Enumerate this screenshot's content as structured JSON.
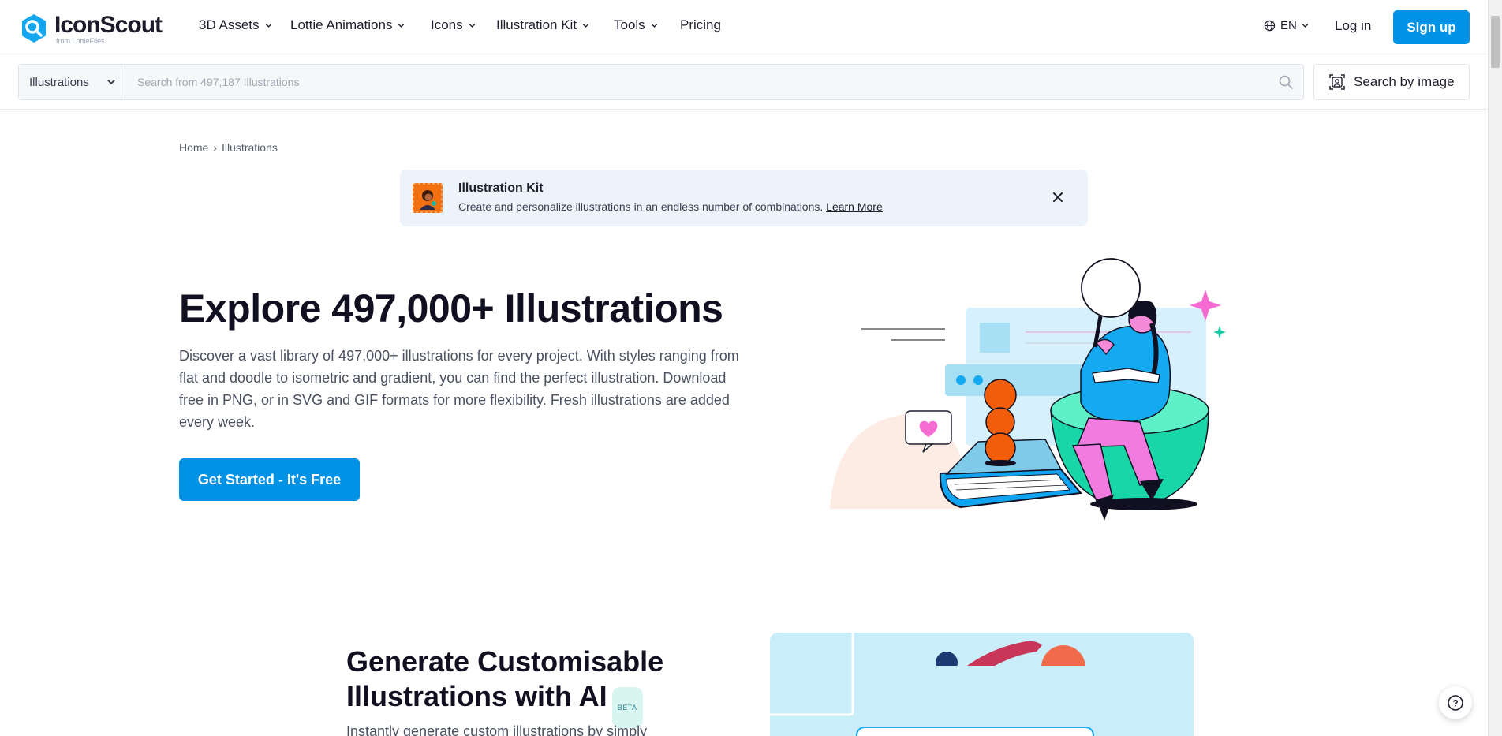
{
  "brand": {
    "name": "IconScout",
    "sub": "from LottieFiles",
    "accent": "#0092e4"
  },
  "nav": {
    "items": [
      {
        "label": "3D Assets",
        "dropdown": true
      },
      {
        "label": "Lottie Animations",
        "dropdown": true
      },
      {
        "label": "Icons",
        "dropdown": true
      },
      {
        "label": "Illustration Kit",
        "dropdown": true
      },
      {
        "label": "Tools",
        "dropdown": true
      },
      {
        "label": "Pricing",
        "dropdown": false
      }
    ],
    "language": "EN",
    "login": "Log in",
    "signup": "Sign up"
  },
  "search": {
    "category": "Illustrations",
    "placeholder": "Search from 497,187 Illustrations",
    "image_search": "Search by image"
  },
  "breadcrumb": {
    "home": "Home",
    "separator": "›",
    "current": "Illustrations"
  },
  "banner": {
    "title": "Illustration Kit",
    "description": "Create and personalize illustrations in an endless number of combinations.",
    "link": "Learn More"
  },
  "hero": {
    "title": "Explore 497,000+ Illustrations",
    "description": "Discover a vast library of 497,000+ illustrations for every project. With styles ranging from flat and doodle to isometric and gradient, you can find the perfect illustration. Download free in PNG, or in SVG and GIF formats for more flexibility. Fresh illustrations are added every week.",
    "cta": "Get Started - It's Free"
  },
  "ai_section": {
    "title": "Generate Customisable Illustrations with AI",
    "badge": "BETA",
    "description": "Instantly generate custom illustrations by simply"
  },
  "help": "?"
}
